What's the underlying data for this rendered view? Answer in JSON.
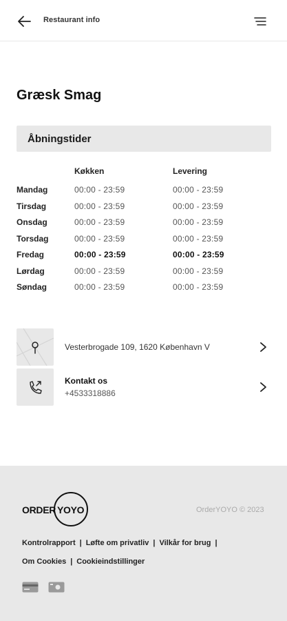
{
  "header": {
    "title": "Restaurant info",
    "back_icon": "arrow-left-icon",
    "menu_icon": "menu-icon"
  },
  "restaurant": {
    "name": "Græsk Smag"
  },
  "opening_hours": {
    "title": "Åbningstider",
    "columns": [
      "Køkken",
      "Levering"
    ],
    "rows": [
      {
        "day": "Mandag",
        "kitchen": "00:00 - 23:59",
        "delivery": "00:00 - 23:59",
        "today": false
      },
      {
        "day": "Tirsdag",
        "kitchen": "00:00 - 23:59",
        "delivery": "00:00 - 23:59",
        "today": false
      },
      {
        "day": "Onsdag",
        "kitchen": "00:00 - 23:59",
        "delivery": "00:00 - 23:59",
        "today": false
      },
      {
        "day": "Torsdag",
        "kitchen": "00:00 - 23:59",
        "delivery": "00:00 - 23:59",
        "today": false
      },
      {
        "day": "Fredag",
        "kitchen": "00:00 - 23:59",
        "delivery": "00:00 - 23:59",
        "today": true
      },
      {
        "day": "Lørdag",
        "kitchen": "00:00 - 23:59",
        "delivery": "00:00 - 23:59",
        "today": false
      },
      {
        "day": "Søndag",
        "kitchen": "00:00 - 23:59",
        "delivery": "00:00 - 23:59",
        "today": false
      }
    ]
  },
  "address": {
    "text": "Vesterbrogade 109, 1620 København V",
    "icon": "map-pin-icon"
  },
  "contact": {
    "label": "Kontakt os",
    "phone": "+4533318886",
    "icon": "phone-icon"
  },
  "footer": {
    "logo_left": "ORDER",
    "logo_right": "YOYO",
    "copyright": "OrderYOYO © 2023",
    "links_row1": [
      "Kontrolrapport",
      "Løfte om privatliv",
      "Vilkår for brug"
    ],
    "links_row2": [
      "Om Cookies",
      "Cookieindstillinger"
    ],
    "payment_icons": [
      "credit-card-icon",
      "cash-icon"
    ]
  },
  "colors": {
    "background": "#ffffff",
    "section": "#e8e8e8",
    "text": "#1a1a1a",
    "muted": "#555555"
  }
}
